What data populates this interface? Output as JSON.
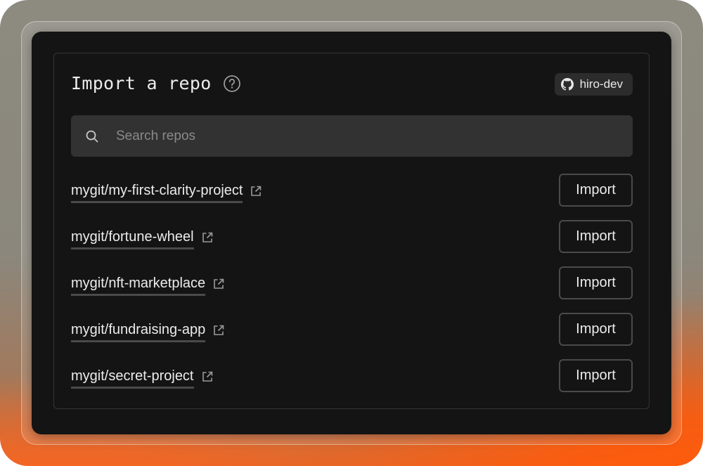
{
  "header": {
    "title": "Import a repo",
    "help_icon": "question-circle-icon",
    "account_icon": "github-icon",
    "account_name": "hiro-dev"
  },
  "search": {
    "placeholder": "Search repos",
    "value": "",
    "icon": "search-icon"
  },
  "repos": [
    {
      "name": "mygit/my-first-clarity-project",
      "action_label": "Import"
    },
    {
      "name": "mygit/fortune-wheel",
      "action_label": "Import"
    },
    {
      "name": "mygit/nft-marketplace",
      "action_label": "Import"
    },
    {
      "name": "mygit/fundraising-app",
      "action_label": "Import"
    },
    {
      "name": "mygit/secret-project",
      "action_label": "Import"
    }
  ],
  "colors": {
    "window_bg": "#141414",
    "search_bg": "#323232",
    "border": "#4a4a4a",
    "accent_orange": "#ff5a0a"
  }
}
